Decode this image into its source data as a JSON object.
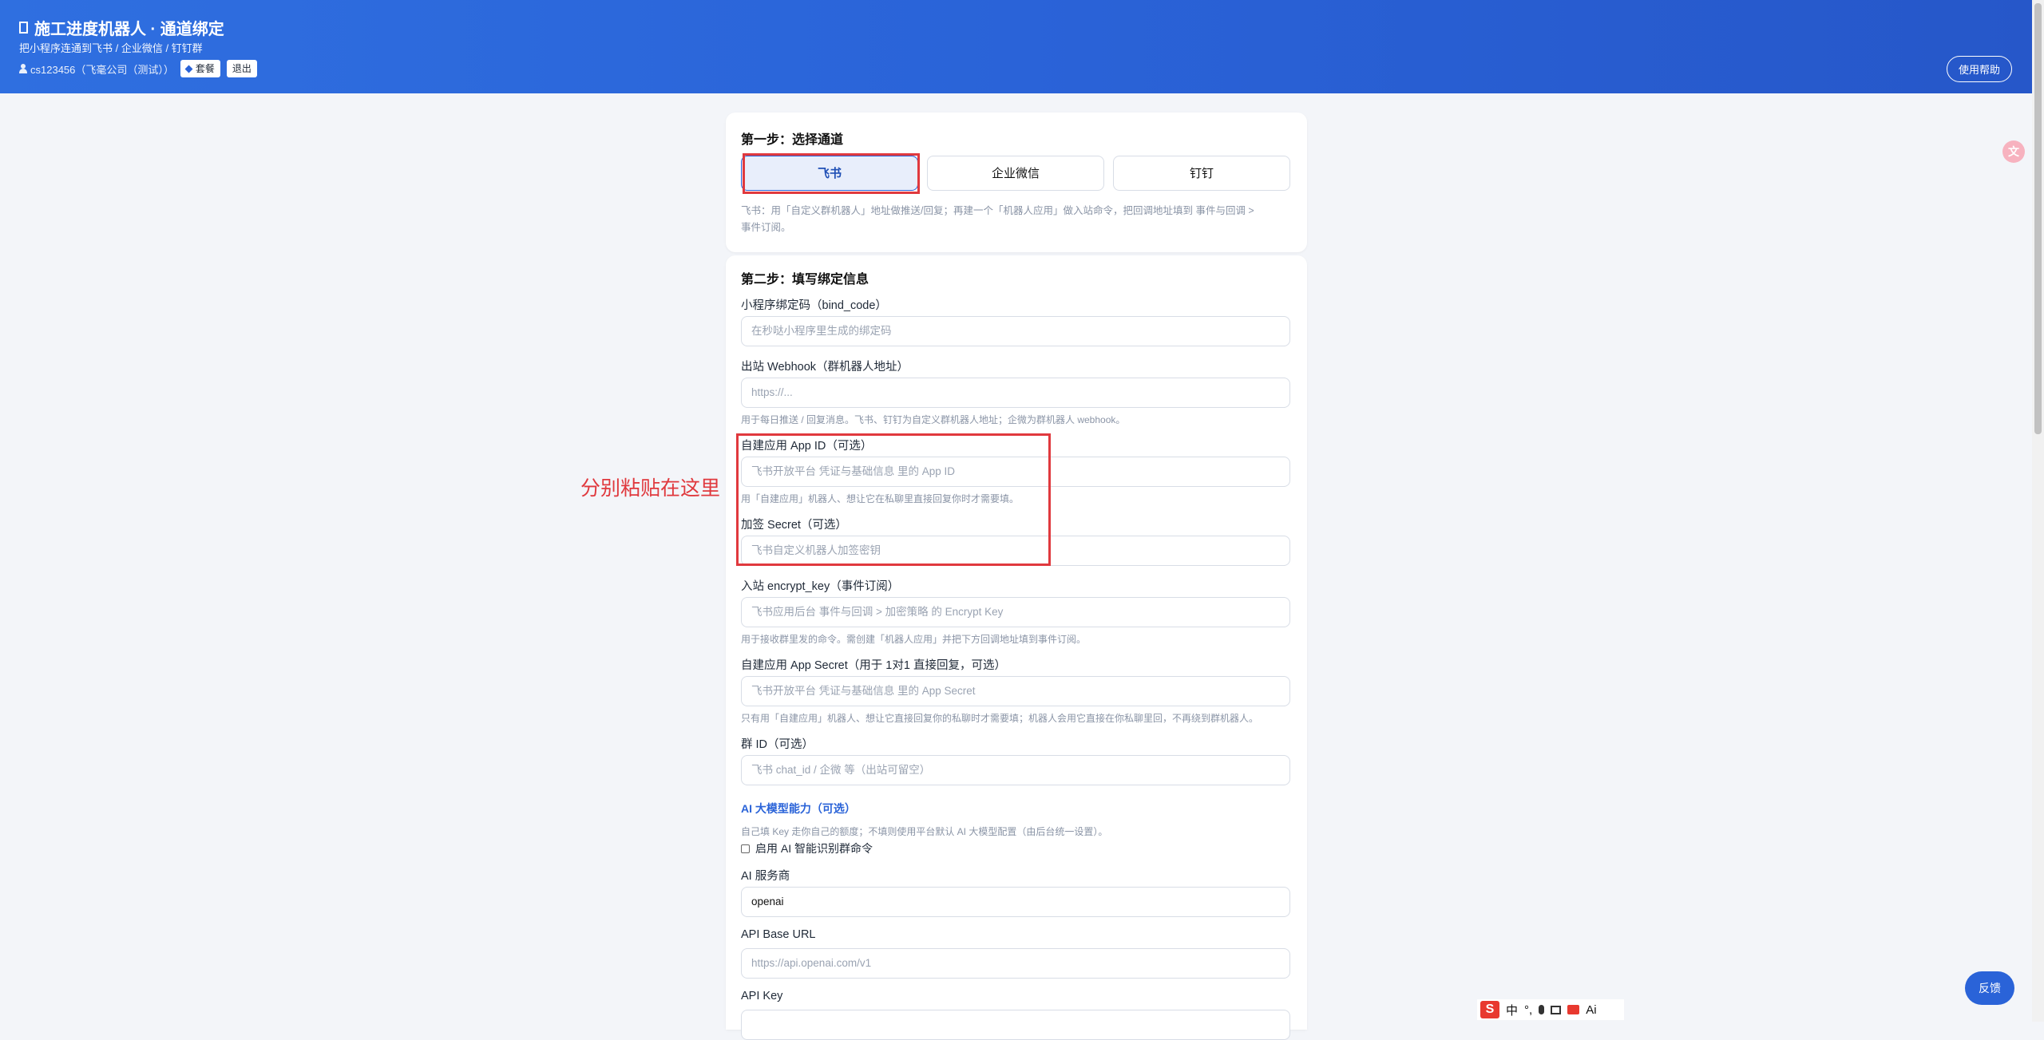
{
  "header": {
    "title": "施工进度机器人 · 通道绑定",
    "subtitle": "把小程序连通到飞书 / 企业微信 / 钉钉群",
    "user": "cs123456（飞毫公司（测试））",
    "plan_label": "套餐",
    "logout_label": "退出",
    "help_label": "使用帮助"
  },
  "step1": {
    "title": "第一步：选择通道",
    "channels": [
      "飞书",
      "企业微信",
      "钉钉"
    ],
    "selected": "飞书",
    "description_line1": "飞书：用「自定义群机器人」地址做推送/回复；再建一个「机器人应用」做入站命令，把回调地址填到 事件与回调 >",
    "description_line2": "事件订阅。"
  },
  "step2": {
    "title": "第二步：填写绑定信息",
    "bind_code": {
      "label": "小程序绑定码（bind_code）",
      "placeholder": "在秒哒小程序里生成的绑定码"
    },
    "webhook": {
      "label": "出站 Webhook（群机器人地址）",
      "placeholder": "https://...",
      "hint": "用于每日推送 / 回复消息。飞书、钉钉为自定义群机器人地址；企微为群机器人 webhook。"
    },
    "app_id": {
      "label": "自建应用 App ID（可选）",
      "placeholder": "飞书开放平台 凭证与基础信息 里的 App ID",
      "hint": "用「自建应用」机器人、想让它在私聊里直接回复你时才需要填。"
    },
    "sign_secret": {
      "label": "加签 Secret（可选）",
      "placeholder": "飞书自定义机器人加签密钥"
    },
    "encrypt_key": {
      "label": "入站 encrypt_key（事件订阅）",
      "placeholder": "飞书应用后台 事件与回调 > 加密策略 的 Encrypt Key",
      "hint": "用于接收群里发的命令。需创建「机器人应用」并把下方回调地址填到事件订阅。"
    },
    "app_secret": {
      "label": "自建应用 App Secret（用于 1对1 直接回复，可选）",
      "placeholder": "飞书开放平台 凭证与基础信息 里的 App Secret",
      "hint": "只有用「自建应用」机器人、想让它直接回复你的私聊时才需要填；机器人会用它直接在你私聊里回，不再绕到群机器人。"
    },
    "group_id": {
      "label": "群 ID（可选）",
      "placeholder": "飞书 chat_id / 企微 等（出站可留空）"
    },
    "ai": {
      "title": "AI 大模型能力（可选）",
      "hint": "自己填 Key 走你自己的额度；不填则使用平台默认 AI 大模型配置（由后台统一设置）。",
      "enable_label": "启用 AI 智能识别群命令",
      "provider_label": "AI 服务商",
      "provider_value": "openai",
      "base_url_label": "API Base URL",
      "base_url_placeholder": "https://api.openai.com/v1",
      "api_key_label": "API Key"
    }
  },
  "annotation": {
    "note": "分别粘贴在这里",
    "color": "#e0393e"
  },
  "widgets": {
    "feedback_label": "反馈",
    "translate_glyph": "文",
    "ime": {
      "logo": "S",
      "mode": "中",
      "punct": "°,",
      "ai": "Ai"
    }
  },
  "colors": {
    "accent": "#2a63d8",
    "header_gradient_start": "#2f6fe0",
    "header_gradient_end": "#2657c9"
  }
}
